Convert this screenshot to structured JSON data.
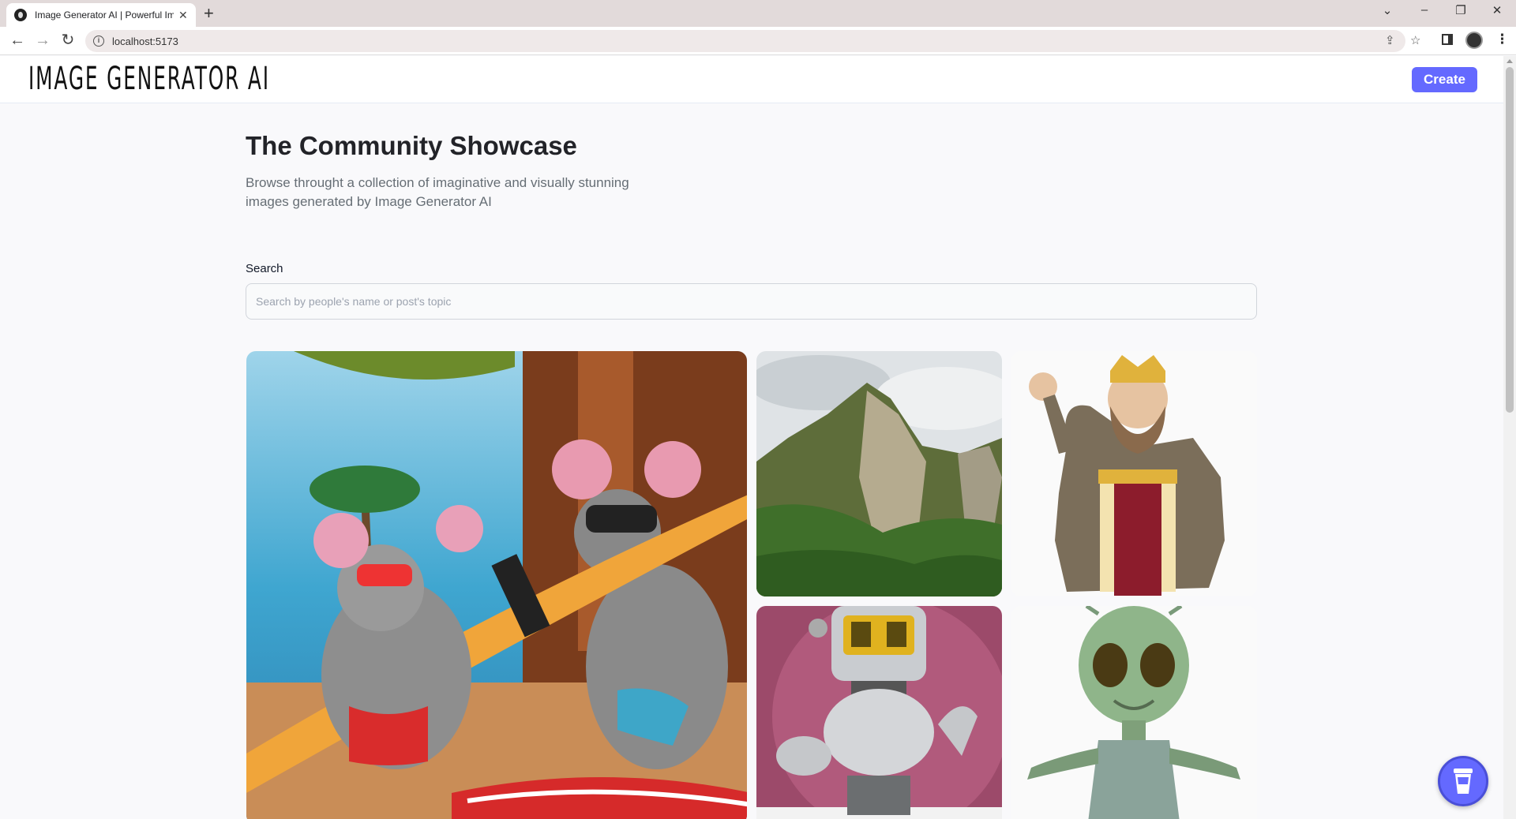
{
  "browser": {
    "tab_title": "Image Generator AI | Powerful Im",
    "tab_close": "✕",
    "new_tab": "+",
    "url": "localhost:5173",
    "window_controls": {
      "dropdown": "⌄",
      "minimize": "–",
      "restore": "❐",
      "close": "✕"
    },
    "nav": {
      "back": "←",
      "forward": "→",
      "reload": "↻"
    },
    "icons": [
      "share-icon",
      "star-icon",
      "side-panel-icon",
      "profile-avatar",
      "menu-icon"
    ]
  },
  "header": {
    "logo_text": "IMAGE GENERATOR AI",
    "create_label": "Create"
  },
  "main": {
    "title": "The Community Showcase",
    "subtitle": "Browse throught a collection of imaginative and visually stunning images generated by Image Generator AI",
    "search": {
      "label": "Search",
      "placeholder": "Search by people's name or post's topic",
      "value": ""
    }
  },
  "gallery": [
    {
      "subject": "mice-surfboard-beach"
    },
    {
      "subject": "rocky-mountain-jungle"
    },
    {
      "subject": "cartoon-king"
    },
    {
      "subject": "robot-character"
    },
    {
      "subject": "green-alien"
    }
  ],
  "floating_action": {
    "icon": "cup-icon"
  },
  "colors": {
    "accent": "#6469ff",
    "title": "#222328",
    "subtitle": "#666e75",
    "page_bg": "#f9f9fb"
  }
}
